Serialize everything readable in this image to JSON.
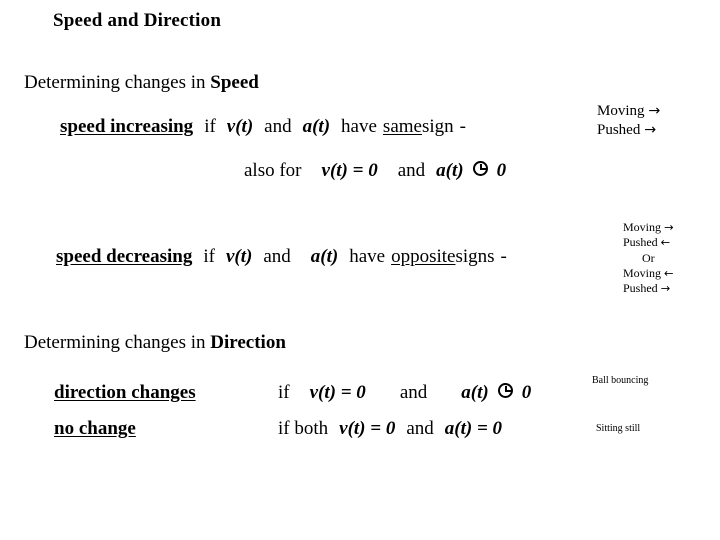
{
  "slide": {
    "title": "Speed and Direction"
  },
  "sections": {
    "speed": {
      "heading_prefix": "Determining changes in ",
      "heading_highlight": "Speed"
    },
    "direction": {
      "heading_prefix": "Determining changes in ",
      "heading_highlight": "Direction"
    }
  },
  "rules": {
    "speed_increasing": {
      "term": "speed increasing",
      "if": "if",
      "v": "v(t)",
      "and": "and",
      "a": "a(t)",
      "have": "have",
      "condition_underlined": "same",
      "condition_rest": " sign",
      "dash": "-"
    },
    "also_for": {
      "lead": "also for",
      "v_eq": "v(t) = 0",
      "and": "and",
      "a": "a(t)",
      "symbol": "not-equal-circle-glyph",
      "zero": "0"
    },
    "speed_decreasing": {
      "term": "speed decreasing",
      "if": "if",
      "v": "v(t)",
      "and": "and",
      "a": "a(t)",
      "have": "have",
      "condition_underlined": "opposite",
      "condition_rest": " signs",
      "dash": "-"
    },
    "direction_changes": {
      "term": "direction changes",
      "if": "if",
      "v_eq": "v(t) = 0",
      "and": "and",
      "a": "a(t)",
      "symbol": "not-equal-circle-glyph",
      "zero": "0"
    },
    "no_change": {
      "term": "no change",
      "if": "if both",
      "v_eq": "v(t) = 0",
      "and": "and",
      "a_eq": "a(t) = 0"
    }
  },
  "notes": {
    "increasing": {
      "line1_label": "Moving",
      "line1_arrow": "→",
      "line2_label": "Pushed",
      "line2_arrow": "→"
    },
    "decreasing": {
      "line1_label": "Moving",
      "line1_arrow": "→",
      "line2_label": "Pushed",
      "line2_arrow": "←",
      "or": "Or",
      "line4_label": "Moving",
      "line4_arrow": "←",
      "line5_label": "Pushed",
      "line5_arrow": "→"
    },
    "ball_bouncing": "Ball bouncing",
    "sitting_still": "Sitting still"
  },
  "colors": {
    "background": "#ffffff",
    "text": "#000000"
  }
}
